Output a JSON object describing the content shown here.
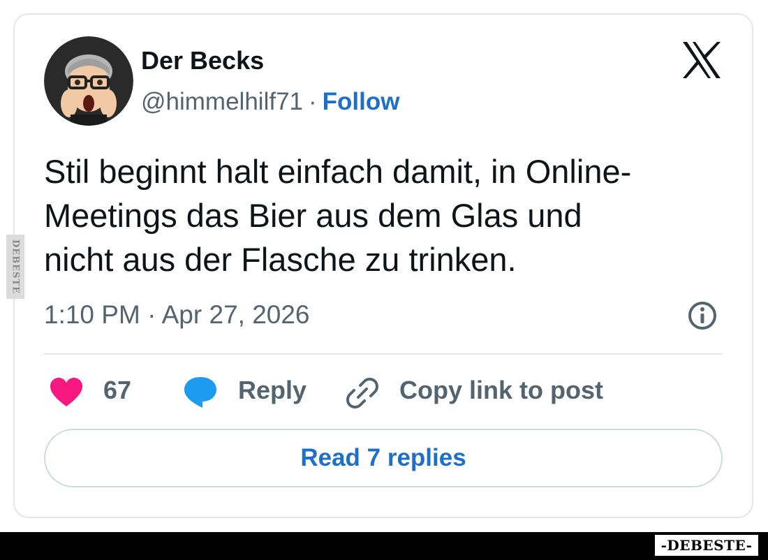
{
  "post": {
    "author_name": "Der Becks",
    "handle": "@himmelhilf71",
    "separator": "·",
    "follow_label": "Follow",
    "text": "Stil beginnt halt einfach damit, in Online-\nMeetings das Bier aus dem Glas und\nnicht aus der Flasche zu trinken.",
    "timestamp": "1:10 PM · Apr 27, 2026"
  },
  "actions": {
    "like_count": "67",
    "reply_label": "Reply",
    "copy_link_label": "Copy link to post",
    "read_replies_label": "Read 7 replies"
  },
  "icons": {
    "platform": "x-logo-icon",
    "info": "info-icon",
    "like": "heart-icon",
    "reply": "speech-bubble-icon",
    "copy": "link-icon"
  },
  "watermark": {
    "side_text": "DEBESTE",
    "logo_text": "-DEBESTE-"
  },
  "colors": {
    "accent": "#1d6fc9",
    "heart": "#f91880",
    "bubble": "#1d9bf0",
    "muted": "#536471",
    "text": "#0f1419"
  }
}
